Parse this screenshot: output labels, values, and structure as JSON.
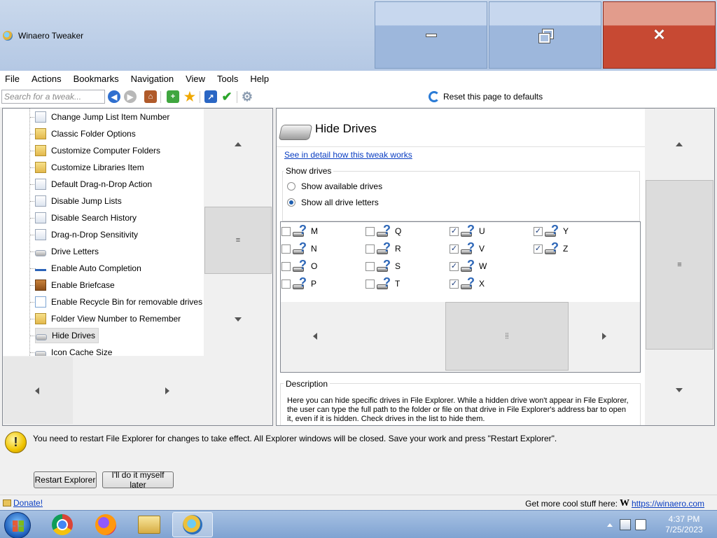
{
  "window": {
    "title": "Winaero Tweaker",
    "minimize_icon": "minimize-icon",
    "restore_icon": "restore-icon",
    "close_icon": "close-icon"
  },
  "menu": [
    "File",
    "Actions",
    "Bookmarks",
    "Navigation",
    "View",
    "Tools",
    "Help"
  ],
  "toolbar": {
    "search_placeholder": "Search for a tweak...",
    "icons": [
      "back-icon",
      "forward-icon",
      "home-icon",
      "add-bookmark-icon",
      "bookmarks-star-icon",
      "shortcut-icon",
      "apply-check-icon",
      "settings-gear-icon"
    ],
    "reset_label": "Reset this page to defaults"
  },
  "tree": {
    "items": [
      {
        "label": "Change Jump List Item Number",
        "icon": "list-icon"
      },
      {
        "label": "Classic Folder Options",
        "icon": "folder-options-icon"
      },
      {
        "label": "Customize Computer Folders",
        "icon": "computer-folders-icon"
      },
      {
        "label": "Customize Libraries Item",
        "icon": "libraries-icon"
      },
      {
        "label": "Default Drag-n-Drop Action",
        "icon": "document-icon"
      },
      {
        "label": "Disable Jump Lists",
        "icon": "list-icon"
      },
      {
        "label": "Disable Search History",
        "icon": "search-history-icon"
      },
      {
        "label": "Drag-n-Drop Sensitivity",
        "icon": "cursor-icon"
      },
      {
        "label": "Drive Letters",
        "icon": "drive-icon"
      },
      {
        "label": "Enable Auto Completion",
        "icon": "autocomplete-icon"
      },
      {
        "label": "Enable Briefcase",
        "icon": "briefcase-icon"
      },
      {
        "label": "Enable Recycle Bin for removable drives",
        "icon": "recycle-bin-icon"
      },
      {
        "label": "Folder View Number to Remember",
        "icon": "folder-icon"
      },
      {
        "label": "Hide Drives",
        "icon": "drive-icon",
        "selected": true
      },
      {
        "label": "Icon Cache Size",
        "icon": "icon-cache-icon"
      }
    ]
  },
  "page": {
    "title": "Hide Drives",
    "detail_link": "See in detail how this tweak works",
    "show_drives_label": "Show drives",
    "radio_available": "Show available drives",
    "radio_all": "Show all drive letters",
    "selected_radio": "all",
    "drives": [
      {
        "letter": "M",
        "checked": false
      },
      {
        "letter": "N",
        "checked": false
      },
      {
        "letter": "O",
        "checked": false
      },
      {
        "letter": "P",
        "checked": false
      },
      {
        "letter": "Q",
        "checked": false
      },
      {
        "letter": "R",
        "checked": false
      },
      {
        "letter": "S",
        "checked": false
      },
      {
        "letter": "T",
        "checked": false
      },
      {
        "letter": "U",
        "checked": true
      },
      {
        "letter": "V",
        "checked": true
      },
      {
        "letter": "W",
        "checked": true
      },
      {
        "letter": "X",
        "checked": true
      },
      {
        "letter": "Y",
        "checked": true
      },
      {
        "letter": "Z",
        "checked": true
      }
    ],
    "description_label": "Description",
    "description_text": "Here you can hide specific drives in File Explorer. While a hidden drive won't appear in File Explorer, the user can type the full path to the folder or file on that drive in File Explorer's address bar to open it, even if it is hidden. Check drives in the list to hide them."
  },
  "notice": {
    "text": "You need to restart File Explorer for changes to take effect. All Explorer windows will be closed. Save your work and press \"Restart Explorer\".",
    "restart_button": "Restart Explorer",
    "later_button": "I'll do it myself later"
  },
  "status": {
    "donate": "Donate!",
    "promo": "Get more cool stuff here:",
    "promo_logo": "W",
    "promo_link": "https://winaero.com"
  },
  "taskbar": {
    "apps": [
      "chrome-icon",
      "firefox-icon",
      "file-explorer-icon",
      "winaero-tweaker-icon"
    ],
    "time": "4:37 PM",
    "date": "7/25/2023"
  },
  "colors": {
    "accent_link": "#0a3ec2",
    "close_button": "#c74933",
    "titlebar": "#b4c8e4"
  }
}
